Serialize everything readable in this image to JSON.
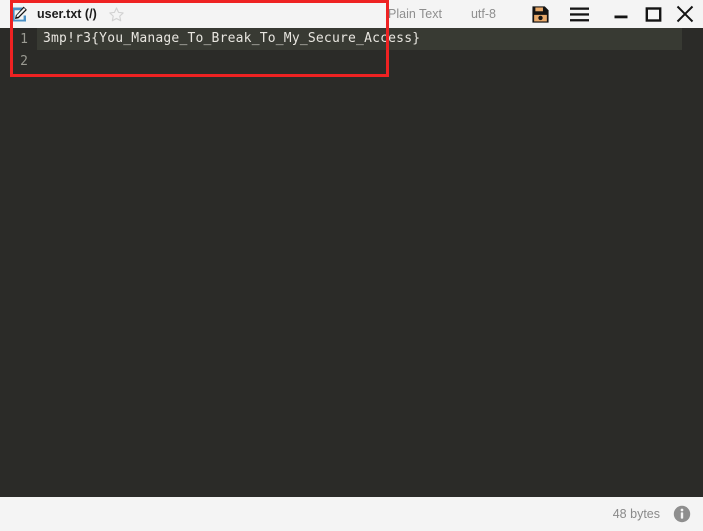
{
  "window": {
    "title_bar": {
      "edit_icon": "edit-pencil-icon",
      "filename": "user.txt (/)",
      "star_icon": "star-outline-icon",
      "syntax_mode": "Plain Text",
      "encoding": "utf-8",
      "save_icon": "save-floppy-icon",
      "menu_icon": "hamburger-menu-icon",
      "minimize_icon": "minimize-icon",
      "maximize_icon": "maximize-icon",
      "close_icon": "close-icon"
    },
    "editor": {
      "lines": [
        {
          "number": "1",
          "text": "3mp!r3{You_Manage_To_Break_To_My_Secure_Access}"
        },
        {
          "number": "2",
          "text": ""
        }
      ],
      "background_color": "#2b2b28",
      "highlight_color": "#383a33",
      "text_color": "#e8e6e0",
      "gutter_color": "#9a9a92"
    },
    "status_bar": {
      "size_label": "48 bytes",
      "info_icon": "info-circle-icon"
    },
    "annotation": {
      "color": "#ee2222"
    }
  }
}
